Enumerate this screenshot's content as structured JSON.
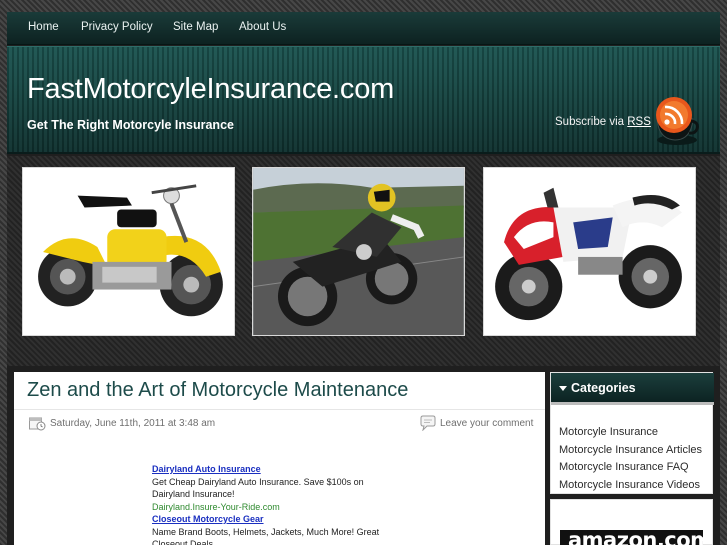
{
  "nav": {
    "items": [
      {
        "label": "Home"
      },
      {
        "label": "Privacy Policy"
      },
      {
        "label": "Site Map"
      },
      {
        "label": "About Us"
      }
    ]
  },
  "header": {
    "site_title": "FastMotorcyleInsurance.com",
    "tagline": "Get The Right Motorcyle Insurance",
    "subscribe_prefix": "Subscribe via",
    "subscribe_link": "RSS",
    "rss_icon": "rss-icon"
  },
  "gallery": {
    "photos": [
      "yellow-mini-motorcycle",
      "rider-leaning-coastal-road",
      "red-white-sport-bike"
    ]
  },
  "post": {
    "title": "Zen and the Art of Motorcycle Maintenance",
    "date": "Saturday, June 11th, 2011 at 3:48 am",
    "comment_link": "Leave your comment",
    "ads": [
      {
        "title": "Dairyland Auto Insurance",
        "text": "Get Cheap Dairyland Auto Insurance. Save $100s on Dairyland Insurance!",
        "url": "Dairyland.Insure-Your-Ride.com"
      },
      {
        "title": "Closeout Motorcycle Gear",
        "text": "Name Brand Boots, Helmets, Jackets, Much More! Great Closeout Deals",
        "url": ""
      }
    ]
  },
  "sidebar": {
    "categories_title": "Categories",
    "categories": [
      "Motorcyle Insurance",
      "Motorcycle Insurance Articles",
      "Motorcycle Insurance FAQ",
      "Motorcycle Insurance Videos"
    ],
    "amazon_logo": "amazon.com"
  },
  "colors": {
    "header_teal": "#14403d",
    "post_title": "#1d4b4a",
    "ad_link": "#1a2fc0",
    "ad_url": "#2f8a2f",
    "rss_orange": "#e8571c"
  }
}
